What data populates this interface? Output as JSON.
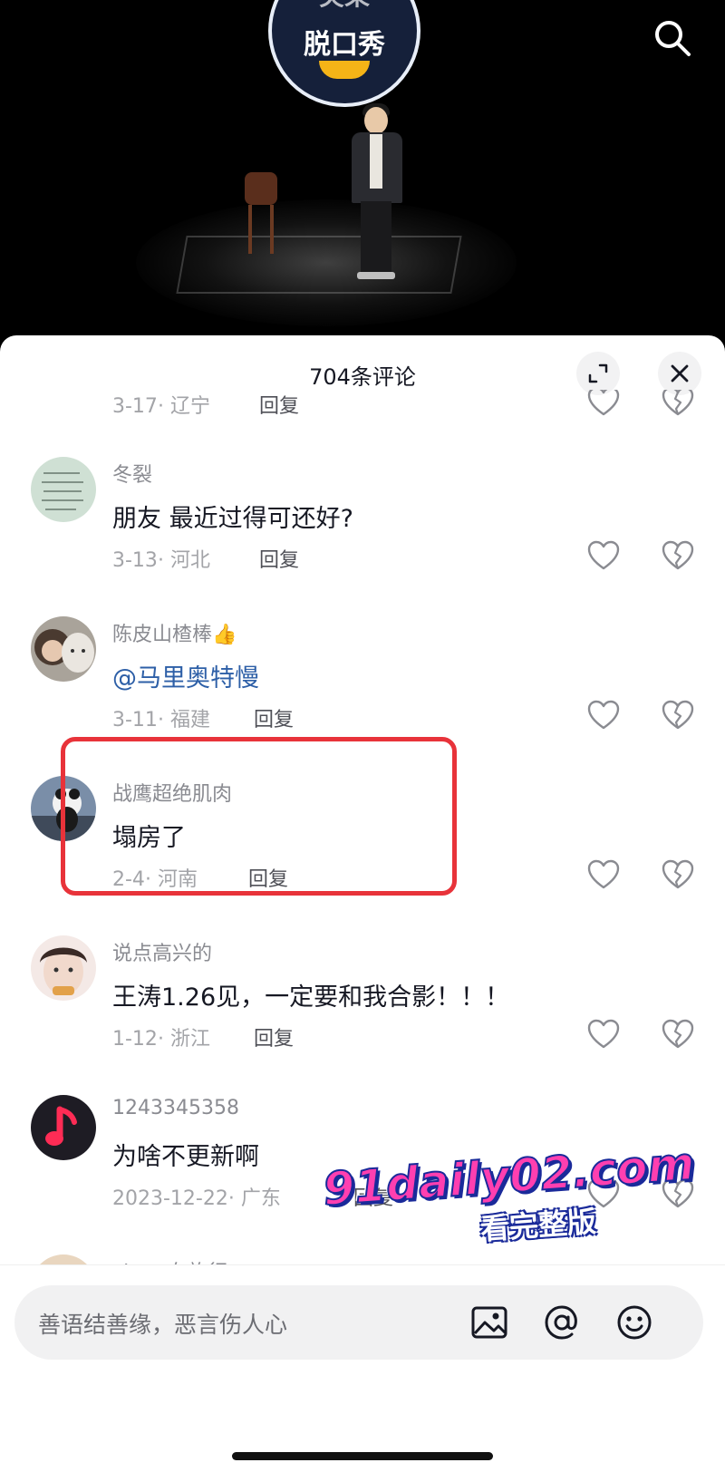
{
  "video": {
    "logo_top": "笑果",
    "logo_text": "脱口秀"
  },
  "sheet": {
    "title": "704条评论"
  },
  "comments": [
    {
      "date": "3-17",
      "location": "辽宁",
      "reply": "回复"
    },
    {
      "username": "冬裂",
      "text": "朋友   最近过得可还好?",
      "date": "3-13",
      "location": "河北",
      "reply": "回复"
    },
    {
      "username": "陈皮山楂棒",
      "badge": "👍",
      "text": "@马里奥特慢",
      "date": "3-11",
      "location": "福建",
      "reply": "回复"
    },
    {
      "username": "战鹰超绝肌肉",
      "text": "塌房了",
      "date": "2-4",
      "location": "河南",
      "reply": "回复"
    },
    {
      "username": "说点高兴的",
      "text": "王涛1.26见，一定要和我合影！！！",
      "date": "1-12",
      "location": "浙江",
      "reply": "回复"
    },
    {
      "username": "1243345358",
      "text": "为啥不更新啊",
      "date": "2023-12-22",
      "location": "广东",
      "reply": "回复"
    },
    {
      "username": "cissy 在旅行"
    }
  ],
  "input": {
    "placeholder": "善语结善缘，恶言伤人心"
  },
  "watermark": {
    "main": "91daily02.com",
    "sub": "看完整版"
  },
  "colors": {
    "highlight": "#e8333a",
    "mention": "#2d5fa7"
  }
}
